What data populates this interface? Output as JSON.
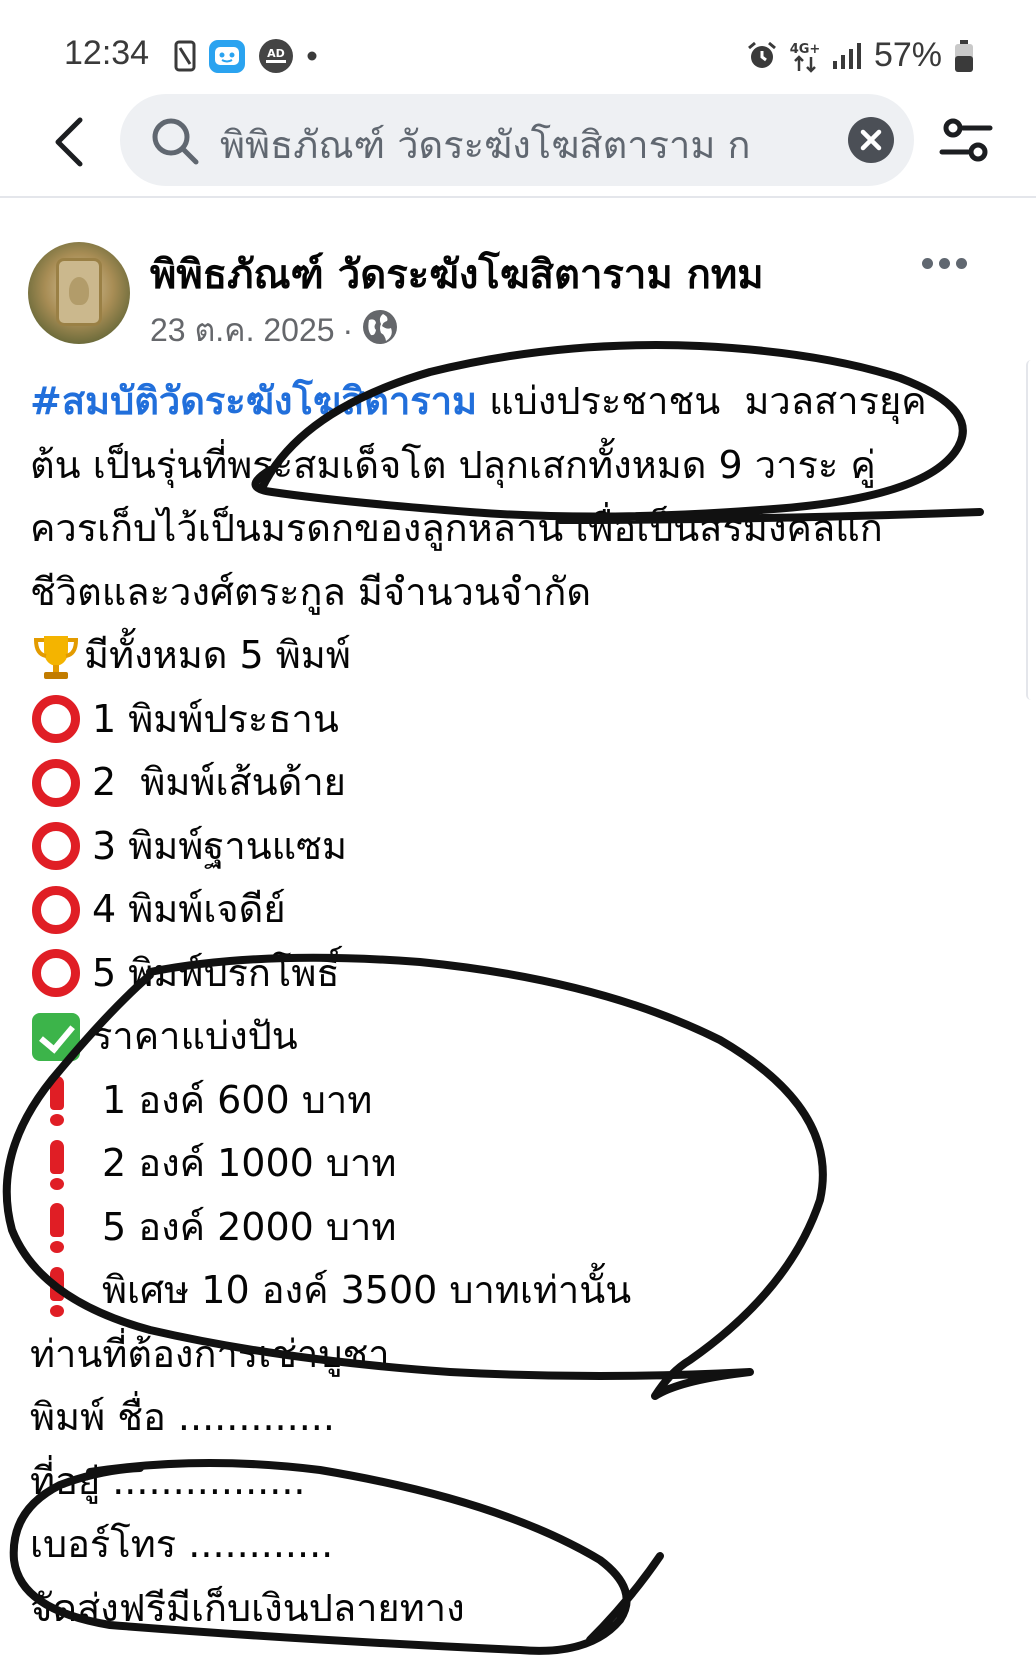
{
  "status_bar": {
    "time": "12:34",
    "battery": "57%",
    "ad_badge": "AD",
    "network": "4G+"
  },
  "search": {
    "query": "พิพิธภัณฑ์ วัดระฆังโฆสิตาราม ก"
  },
  "post": {
    "author": "พิพิธภัณฑ์ วัดระฆังโฆสิตาราม กทม",
    "date": "23 ต.ค. 2025",
    "meta_separator": "·",
    "hashtag": "#สมบัติวัดระฆังโฆสิตาราม",
    "lines": [
      " แบ่งประชาชน  มวลสารยุค",
      "ต้น เป็นรุ่นที่พระสมเด็จโต ปลุกเสกทั้งหมด 9 วาระ คู่",
      "ควรเก็บไว้เป็นมรดกของลูกหลาน เพื่อเป็นสิริมงคลแก่",
      "ชีวิตและวงศ์ตระกูล มีจำนวนจำกัด"
    ],
    "total_line": "มีทั้งหมด 5 พิมพ์",
    "molds": [
      "1 พิมพ์ประธาน",
      "2  พิมพ์เส้นด้าย",
      "3 พิมพ์ฐานแซม",
      "4 พิมพ์เจดีย์",
      "5 พิมพ์ปรกโพธิ์"
    ],
    "price_heading": "ราคาแบ่งปัน",
    "prices": [
      "1 องค์ 600 บาท",
      "2 องค์ 1000 บาท",
      "5 องค์ 2000 บาท",
      "พิเศษ 10 องค์ 3500 บาทเท่านั้น"
    ],
    "order_lines": [
      "ท่านที่ต้องการเช่าบูชา",
      "พิมพ์ ชื่อ .............",
      "ที่อยู่ ................",
      "เบอร์โทร ............",
      "จัดส่งฟรีมีเก็บเงินปลายทาง"
    ]
  },
  "colors": {
    "hashtag": "#216fdb",
    "emoji_red": "#e01e25",
    "emoji_green": "#3cb44a",
    "annotation": "#111111"
  },
  "icons": [
    "back-arrow-icon",
    "search-icon",
    "clear-icon",
    "filter-icon",
    "globe-icon",
    "more-icon",
    "trophy-icon",
    "red-circle-icon",
    "check-mark-icon",
    "exclamation-icon"
  ]
}
